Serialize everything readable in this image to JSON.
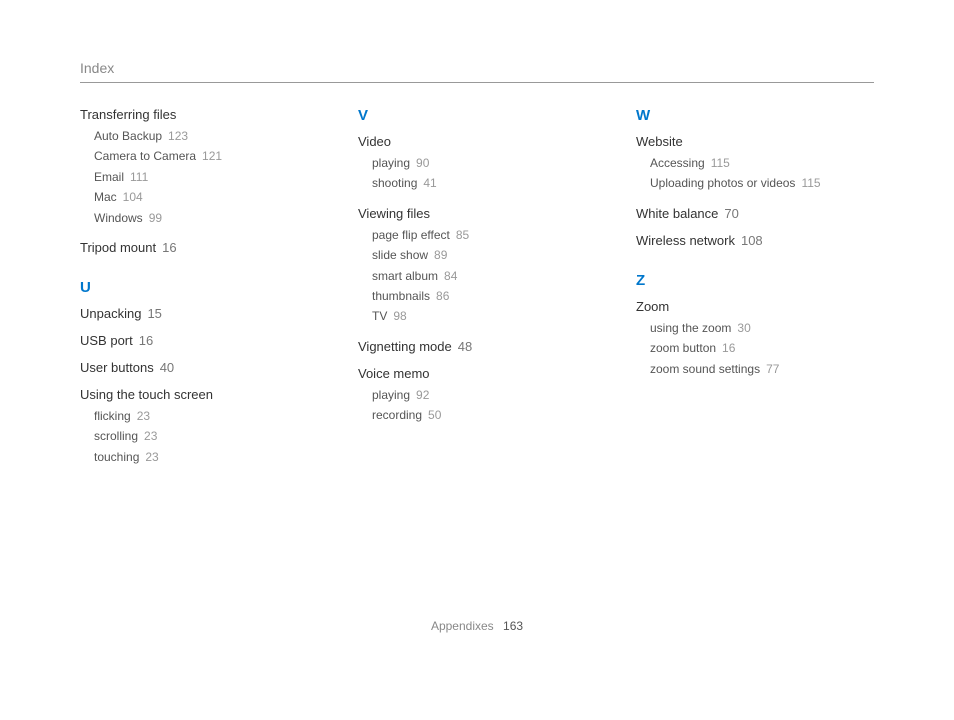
{
  "header": {
    "title": "Index"
  },
  "footer": {
    "section": "Appendixes",
    "page": "163"
  },
  "columns": [
    {
      "blocks": [
        {
          "type": "entry",
          "title": "Transferring files",
          "subs": [
            {
              "label": "Auto Backup",
              "page": "123"
            },
            {
              "label": "Camera to Camera",
              "page": "121"
            },
            {
              "label": "Email",
              "page": "111"
            },
            {
              "label": "Mac",
              "page": "104"
            },
            {
              "label": "Windows",
              "page": "99"
            }
          ]
        },
        {
          "type": "entry",
          "title": "Tripod mount",
          "page": "16"
        },
        {
          "type": "letter",
          "letter": "U"
        },
        {
          "type": "entry",
          "title": "Unpacking",
          "page": "15"
        },
        {
          "type": "entry",
          "title": "USB port",
          "page": "16"
        },
        {
          "type": "entry",
          "title": "User buttons",
          "page": "40"
        },
        {
          "type": "entry",
          "title": "Using the touch screen",
          "subs": [
            {
              "label": "flicking",
              "page": "23"
            },
            {
              "label": "scrolling",
              "page": "23"
            },
            {
              "label": "touching",
              "page": "23"
            }
          ]
        }
      ]
    },
    {
      "blocks": [
        {
          "type": "letter",
          "letter": "V"
        },
        {
          "type": "entry",
          "title": "Video",
          "subs": [
            {
              "label": "playing",
              "page": "90"
            },
            {
              "label": "shooting",
              "page": "41"
            }
          ]
        },
        {
          "type": "entry",
          "title": "Viewing files",
          "subs": [
            {
              "label": "page flip effect",
              "page": "85"
            },
            {
              "label": "slide show",
              "page": "89"
            },
            {
              "label": "smart album",
              "page": "84"
            },
            {
              "label": "thumbnails",
              "page": "86"
            },
            {
              "label": "TV",
              "page": "98"
            }
          ]
        },
        {
          "type": "entry",
          "title": "Vignetting mode",
          "page": "48"
        },
        {
          "type": "entry",
          "title": "Voice memo",
          "subs": [
            {
              "label": "playing",
              "page": "92"
            },
            {
              "label": "recording",
              "page": "50"
            }
          ]
        }
      ]
    },
    {
      "blocks": [
        {
          "type": "letter",
          "letter": "W"
        },
        {
          "type": "entry",
          "title": "Website",
          "subs": [
            {
              "label": "Accessing",
              "page": "115"
            },
            {
              "label": "Uploading photos or videos",
              "page": "115"
            }
          ]
        },
        {
          "type": "entry",
          "title": "White balance",
          "page": "70"
        },
        {
          "type": "entry",
          "title": "Wireless network",
          "page": "108"
        },
        {
          "type": "letter",
          "letter": "Z"
        },
        {
          "type": "entry",
          "title": "Zoom",
          "subs": [
            {
              "label": "using the zoom",
              "page": "30"
            },
            {
              "label": "zoom button",
              "page": "16"
            },
            {
              "label": "zoom sound settings",
              "page": "77"
            }
          ]
        }
      ]
    }
  ]
}
